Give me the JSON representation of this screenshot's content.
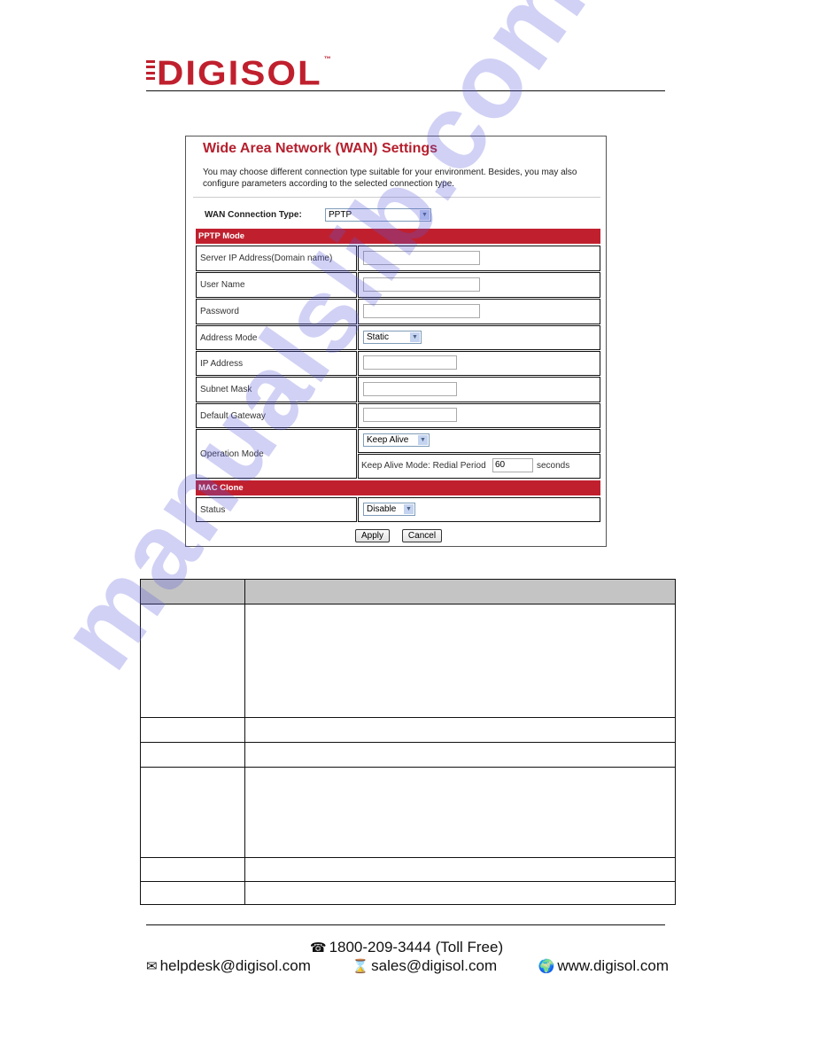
{
  "brand": {
    "logo_text": "IGISOL",
    "logo_full": "DIGISOL",
    "tm": "™",
    "color": "#c0202e"
  },
  "screenshot": {
    "title": "Wide Area Network (WAN) Settings",
    "description": "You may choose different connection type suitable for your environment. Besides, you may also configure parameters according to the selected connection type.",
    "connection_type_label": "WAN Connection Type:",
    "connection_type_value": "PPTP",
    "pptp_section": "PPTP Mode",
    "fields": {
      "server_ip": {
        "label": "Server IP Address(Domain name)",
        "value": ""
      },
      "user_name": {
        "label": "User Name",
        "value": ""
      },
      "password": {
        "label": "Password",
        "value": ""
      },
      "address_mode": {
        "label": "Address Mode",
        "value": "Static"
      },
      "ip_address": {
        "label": "IP Address",
        "value": ""
      },
      "subnet_mask": {
        "label": "Subnet Mask",
        "value": ""
      },
      "default_gateway": {
        "label": "Default Gateway",
        "value": ""
      },
      "operation_mode": {
        "label": "Operation Mode",
        "value": "Keep Alive"
      },
      "redial": {
        "label": "Keep Alive Mode: Redial Period",
        "value": "60",
        "unit": "seconds"
      }
    },
    "mac_section": "MAC Clone",
    "mac_status": {
      "label": "Status",
      "value": "Disable"
    },
    "apply_label": "Apply",
    "cancel_label": "Cancel",
    "accent_color": "#c0202e"
  },
  "description_table": {
    "header": [
      "",
      ""
    ],
    "rows": [
      [
        "",
        ""
      ],
      [
        "",
        ""
      ],
      [
        "",
        ""
      ],
      [
        "",
        ""
      ],
      [
        "",
        ""
      ],
      [
        "",
        ""
      ]
    ]
  },
  "footer": {
    "phone": "1800-209-3444 (Toll Free)",
    "email_helpdesk": "helpdesk@digisol.com",
    "email_sales": "sales@digisol.com",
    "website": "www.digisol.com",
    "icons": {
      "phone": "telephone-icon",
      "mail": "envelope-icon",
      "sales": "hourglass-icon",
      "web": "globe-icon"
    }
  },
  "watermark": "manualslib.com"
}
